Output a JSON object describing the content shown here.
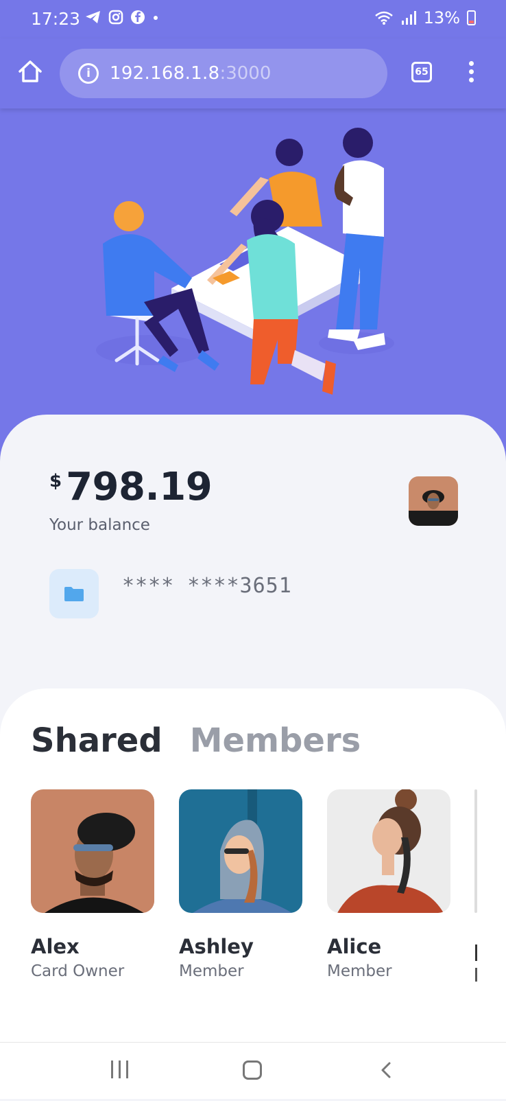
{
  "status_bar": {
    "time": "17:23",
    "battery": "13%",
    "icons": [
      "telegram-icon",
      "instagram-icon",
      "facebook-icon",
      "dot-icon",
      "wifi-icon",
      "signal-icon",
      "battery-icon"
    ]
  },
  "browser": {
    "url_host": "192.168.1.8",
    "url_port": ":3000",
    "tab_count": "65"
  },
  "balance": {
    "currency": "$",
    "amount": "798.19",
    "label": "Your balance",
    "card_number": "**** ****3651"
  },
  "members": {
    "title_shared": "Shared",
    "title_members": "Members",
    "list": [
      {
        "name": "Alex",
        "role": "Card Owner"
      },
      {
        "name": "Ashley",
        "role": "Member"
      },
      {
        "name": "Alice",
        "role": "Member"
      }
    ]
  },
  "colors": {
    "brand": "#7577e8",
    "panel": "#f3f4f9",
    "chip": "#dcebfb",
    "chip_icon": "#52a7ec"
  }
}
